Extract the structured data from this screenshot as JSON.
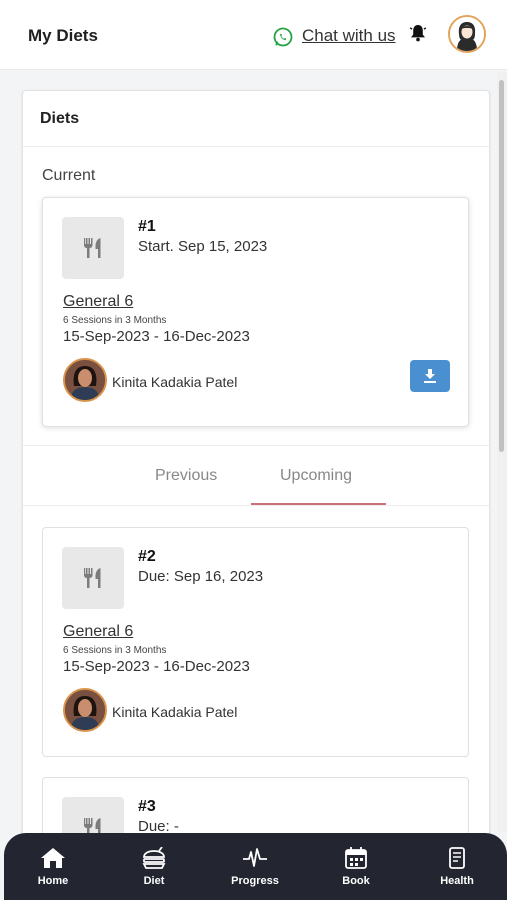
{
  "header": {
    "title": "My Diets",
    "chat_label": "Chat with us"
  },
  "main": {
    "heading": "Diets",
    "current_label": "Current",
    "current": {
      "number": "#1",
      "meta": "Start. Sep 15, 2023",
      "plan": "General 6",
      "sessions": "6 Sessions in 3 Months",
      "range": "15-Sep-2023 - 16-Dec-2023",
      "coach": "Kinita Kadakia Patel"
    },
    "tabs": [
      {
        "label": "Previous",
        "active": false
      },
      {
        "label": "Upcoming",
        "active": true
      }
    ],
    "upcoming": [
      {
        "number": "#2",
        "meta": "Due: Sep 16, 2023",
        "plan": "General 6",
        "sessions": "6 Sessions in 3 Months",
        "range": "15-Sep-2023 - 16-Dec-2023",
        "coach": "Kinita Kadakia Patel"
      },
      {
        "number": "#3",
        "meta": "Due: -"
      }
    ]
  },
  "bottom_nav": [
    {
      "label": "Home",
      "icon": "home-icon"
    },
    {
      "label": "Diet",
      "icon": "diet-icon"
    },
    {
      "label": "Progress",
      "icon": "progress-icon"
    },
    {
      "label": "Book",
      "icon": "book-icon"
    },
    {
      "label": "Health",
      "icon": "health-icon"
    }
  ],
  "colors": {
    "accent_blue": "#4a8fd0",
    "tab_underline": "#c97078",
    "nav_bg": "#232631",
    "whatsapp": "#25a244"
  }
}
